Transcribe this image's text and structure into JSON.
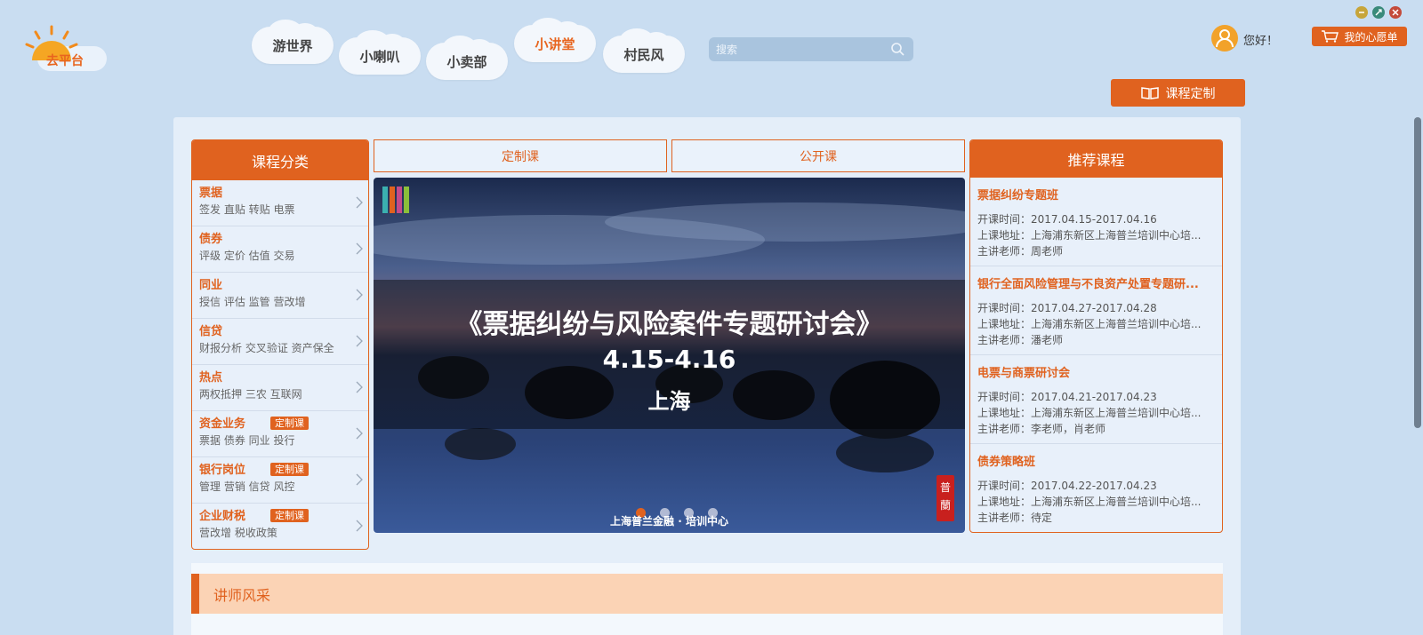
{
  "app": {
    "logo_text": "去平台"
  },
  "nav": {
    "items": [
      {
        "label": "游世界",
        "active": false
      },
      {
        "label": "小喇叭",
        "active": false
      },
      {
        "label": "小卖部",
        "active": false
      },
      {
        "label": "小讲堂",
        "active": true
      },
      {
        "label": "村民风",
        "active": false
      }
    ]
  },
  "search": {
    "placeholder": "搜索"
  },
  "user": {
    "greeting": "您好！",
    "wishlist_label": "我的心愿单",
    "custom_course_label": "课程定制"
  },
  "categories": {
    "title": "课程分类",
    "items": [
      {
        "title": "票据",
        "sub": "签发 直贴 转贴 电票",
        "badge": ""
      },
      {
        "title": "债券",
        "sub": "评级 定价 估值 交易",
        "badge": ""
      },
      {
        "title": "同业",
        "sub": "授信 评估 监管 营改增",
        "badge": ""
      },
      {
        "title": "信贷",
        "sub": "财报分析 交叉验证 资产保全",
        "badge": ""
      },
      {
        "title": "热点",
        "sub": "两权抵押 三农 互联网",
        "badge": ""
      },
      {
        "title": "资金业务",
        "sub": "票据 债券 同业 投行",
        "badge": "定制课"
      },
      {
        "title": "银行岗位",
        "sub": "管理 营销 信贷 风控",
        "badge": "定制课"
      },
      {
        "title": "企业财税",
        "sub": "营改增 税收政策",
        "badge": "定制课"
      }
    ]
  },
  "tabs": [
    {
      "label": "定制课"
    },
    {
      "label": "公开课"
    }
  ],
  "banner": {
    "title": "《票据纠纷与风险案件专题研讨会》",
    "date": "4.15-4.16",
    "city": "上海",
    "footer": "上海普兰金融 · 培训中心",
    "seal": "普蘭",
    "active_slide": 0,
    "slide_count": 4
  },
  "recommended": {
    "title": "推荐课程",
    "items": [
      {
        "title": "票据纠纷专题班",
        "time": "开课时间：2017.04.15-2017.04.16",
        "addr": "上课地址：上海浦东新区上海普兰培训中心培...",
        "teacher": "主讲老师：周老师"
      },
      {
        "title": "银行全面风险管理与不良资产处置专题研...",
        "time": "开课时间：2017.04.27-2017.04.28",
        "addr": "上课地址：上海浦东新区上海普兰培训中心培...",
        "teacher": "主讲老师：潘老师"
      },
      {
        "title": "电票与商票研讨会",
        "time": "开课时间：2017.04.21-2017.04.23",
        "addr": "上课地址：上海浦东新区上海普兰培训中心培...",
        "teacher": "主讲老师：李老师，肖老师"
      },
      {
        "title": "债券策略班",
        "time": "开课时间：2017.04.22-2017.04.23",
        "addr": "上课地址：上海浦东新区上海普兰培训中心培...",
        "teacher": "主讲老师：待定"
      }
    ]
  },
  "lecturers": {
    "title": "讲师风采"
  },
  "colors": {
    "accent": "#e0621f",
    "background": "#c9ddf1"
  }
}
